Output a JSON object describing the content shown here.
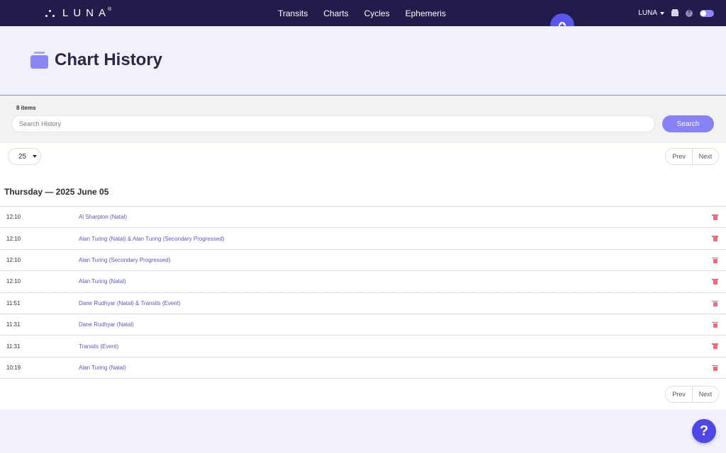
{
  "brand": {
    "name": "LUNA",
    "mark": "®"
  },
  "nav": {
    "items": [
      "Transits",
      "Charts",
      "Cycles",
      "Ephemeris"
    ]
  },
  "user": {
    "name": "LUNA"
  },
  "header": {
    "title": "Chart History"
  },
  "search": {
    "count_text": "8 items",
    "placeholder": "Search History",
    "value": "",
    "button_label": "Search"
  },
  "pagination": {
    "per_page": "25",
    "prev": "Prev",
    "next": "Next"
  },
  "history": {
    "date_heading": "Thursday — 2025 June 05",
    "rows": [
      {
        "time": "12:10",
        "chart": "Al Sharpton (Natal)"
      },
      {
        "time": "12:10",
        "chart": "Alan Turing (Natal) & Alan Turing (Secondary Progressed)"
      },
      {
        "time": "12:10",
        "chart": "Alan Turing (Secondary Progressed)"
      },
      {
        "time": "12:10",
        "chart": "Alan Turing (Natal)"
      },
      {
        "time": "11:51",
        "chart": "Dane Rudhyar (Natal) & Transits (Event)"
      },
      {
        "time": "11:31",
        "chart": "Dane Rudhyar (Natal)"
      },
      {
        "time": "11:31",
        "chart": "Transits (Event)"
      },
      {
        "time": "10:19",
        "chart": "Alan Turing (Natal)"
      }
    ]
  },
  "help": {
    "label": "?"
  },
  "colors": {
    "nav_bg": "#221c4a",
    "accent": "#5b55f0",
    "button": "#8783f7",
    "link": "#5a57d8",
    "delete": "#ef6a7b"
  }
}
